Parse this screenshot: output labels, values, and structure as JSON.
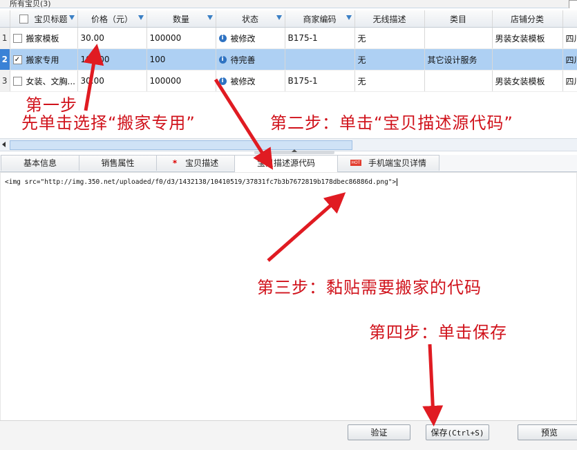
{
  "top_tab_label": "所有宝贝(3)",
  "grid": {
    "columns": [
      "宝贝标题",
      "价格（元）",
      "数量",
      "状态",
      "商家编码",
      "无线描述",
      "类目",
      "店铺分类",
      ""
    ],
    "rows": [
      {
        "num": "1",
        "title": "搬家模板",
        "price": "30.00",
        "qty": "100000",
        "status": "被修改",
        "code": "B175-1",
        "wireless": "无",
        "category": "",
        "shop_cat": "男装女装模板",
        "extra": "四川"
      },
      {
        "num": "2",
        "title": "搬家专用",
        "price": "100.00",
        "qty": "100",
        "status": "待完善",
        "code": "",
        "wireless": "无",
        "category": "其它设计服务",
        "shop_cat": "",
        "extra": "四川"
      },
      {
        "num": "3",
        "title": "女装、文胸...",
        "price": "30.00",
        "qty": "100000",
        "status": "被修改",
        "code": "B175-1",
        "wireless": "无",
        "category": "",
        "shop_cat": "男装女装模板",
        "extra": "四川"
      }
    ],
    "checked_row": "2"
  },
  "tabs": [
    "基本信息",
    "销售属性",
    "宝贝描述",
    "宝贝描述源代码",
    "手机端宝贝详情"
  ],
  "active_tab": "宝贝描述源代码",
  "hot_badge": "HOT",
  "required_mark": "*",
  "editor_code": "<img src=\"http://img.350.net/uploaded/f0/d3/1432138/10410519/37831fc7b3b7672819b178dbec86886d.png\">",
  "buttons": {
    "verify": "验证",
    "save": "保存",
    "save_shortcut": "(Ctrl+S)",
    "preview": "预览"
  },
  "annotations": {
    "step1_a": "第一步",
    "step1_b": "先单击选择“搬家专用”",
    "step2": "第二步：单击“宝贝描述源代码”",
    "step3": "第三步：黏贴需要搬家的代码",
    "step4": "第四步：单击保存"
  },
  "colors": {
    "annotation_red": "#d0121b",
    "selected_row": "#aed0f3",
    "filter_icon_blue": "#3a7fc4"
  }
}
